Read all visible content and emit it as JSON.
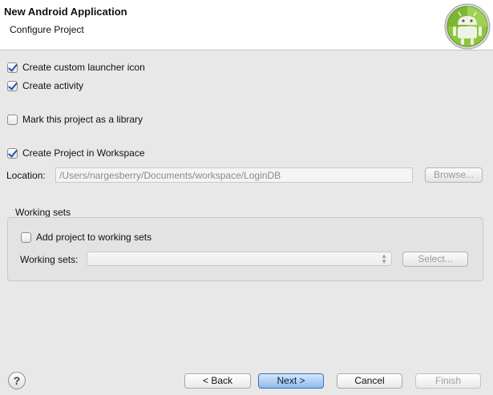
{
  "header": {
    "title": "New Android Application",
    "subtitle": "Configure Project",
    "logo_icon": "android-robot-icon"
  },
  "options": {
    "launcher_icon": {
      "label": "Create custom launcher icon",
      "checked": true
    },
    "activity": {
      "label": "Create activity",
      "checked": true
    },
    "library": {
      "label": "Mark this project as a library",
      "checked": false
    },
    "workspace": {
      "label": "Create Project in Workspace",
      "checked": true
    }
  },
  "location": {
    "label": "Location:",
    "value": "/Users/nargesberry/Documents/workspace/LoginDB",
    "browse_label": "Browse..."
  },
  "working_sets": {
    "group_title": "Working sets",
    "add_label": "Add project to working sets",
    "add_checked": false,
    "sets_label": "Working sets:",
    "sets_value": "",
    "select_label": "Select..."
  },
  "footer": {
    "help_icon": "question-mark-icon",
    "help_glyph": "?",
    "back_label": "< Back",
    "next_label": "Next >",
    "cancel_label": "Cancel",
    "finish_label": "Finish"
  },
  "colors": {
    "accent": "#8fbaf0",
    "android_green": "#8cc63f",
    "checkmark": "#1b55b8"
  }
}
